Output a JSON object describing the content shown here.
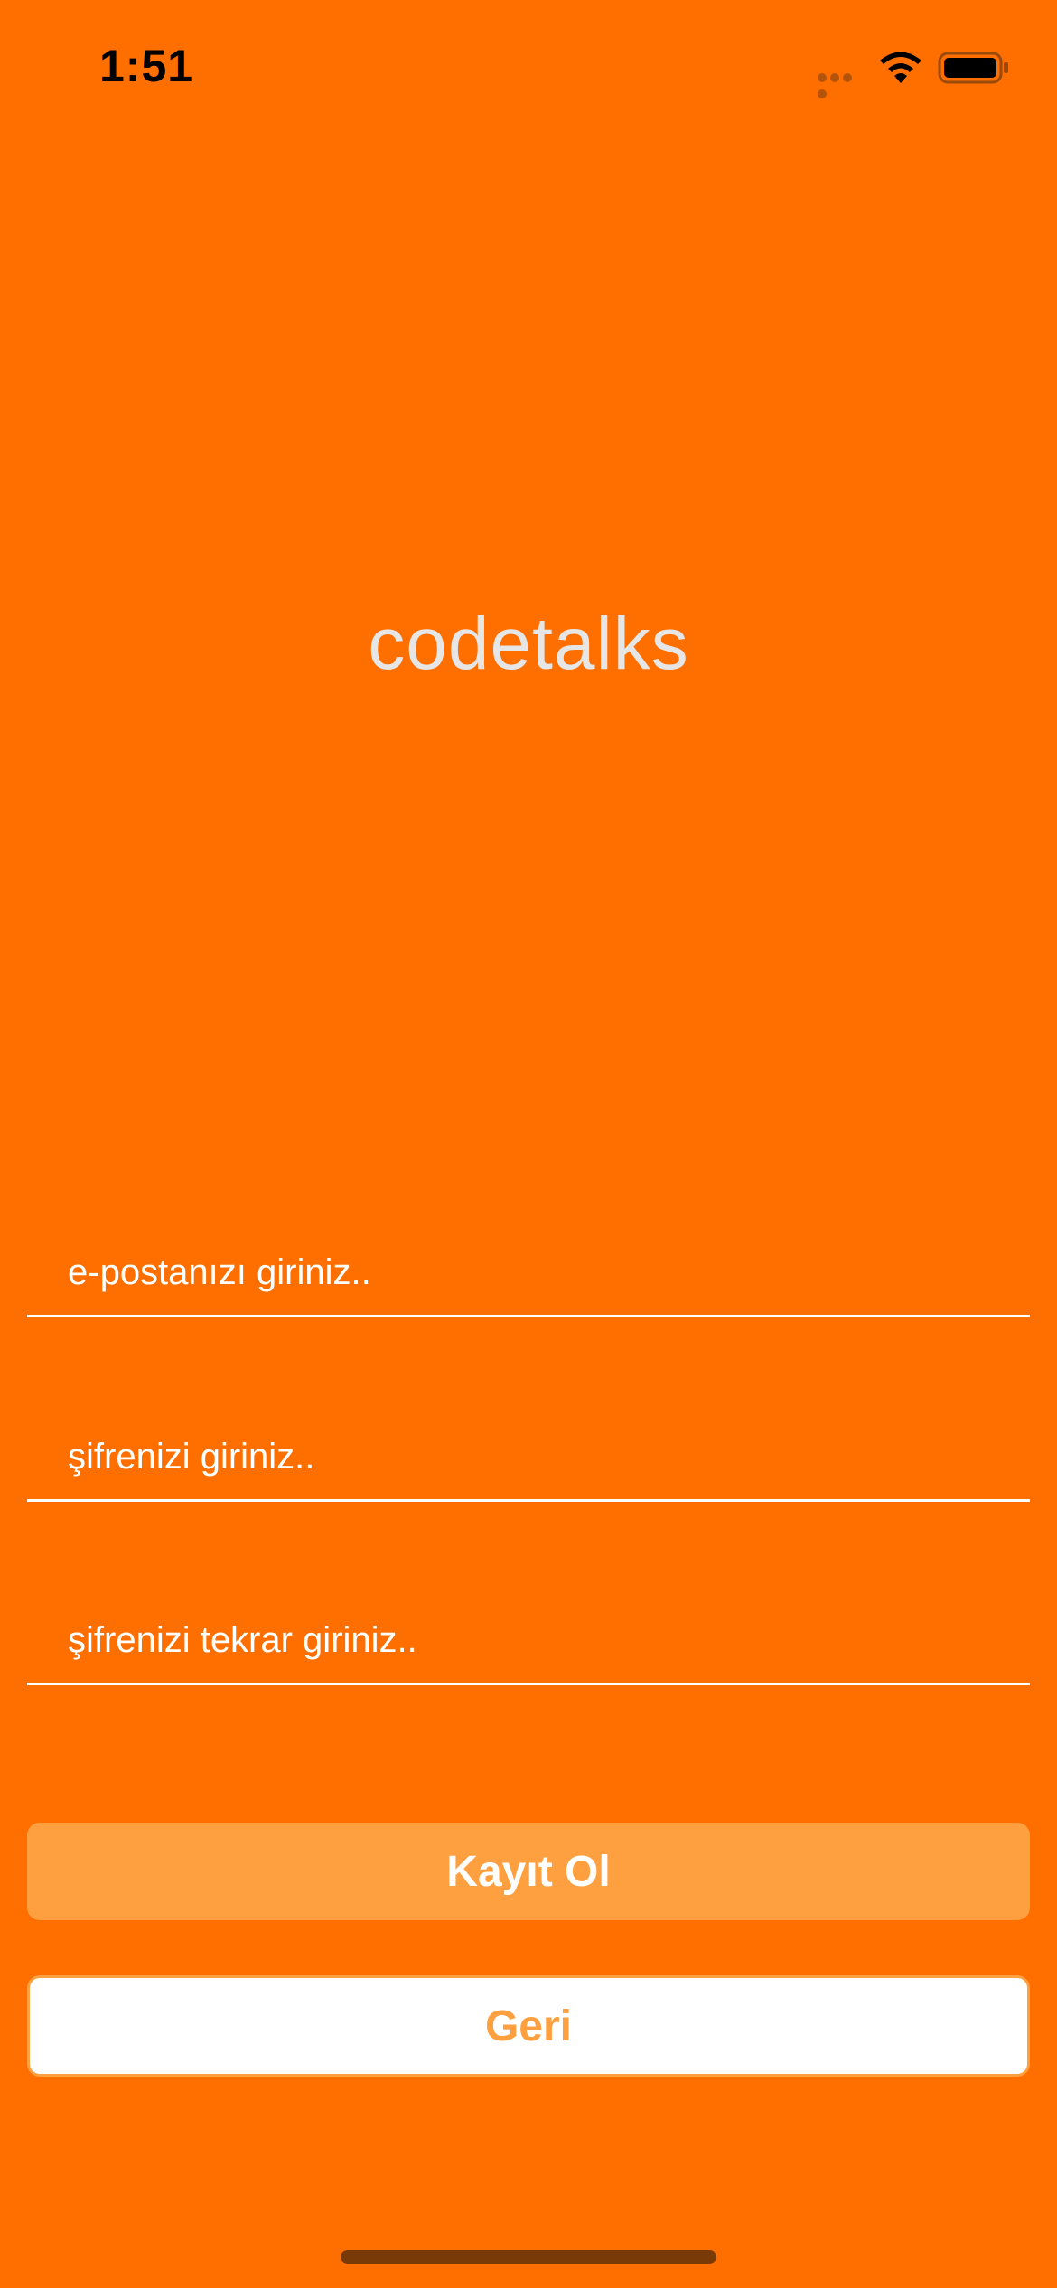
{
  "status_bar": {
    "time": "1:51",
    "icons": [
      "signal-icon",
      "wifi-icon",
      "battery-icon"
    ]
  },
  "app": {
    "title": "codetalks"
  },
  "form": {
    "email_placeholder": "e-postanızı giriniz..",
    "password_placeholder": "şifrenizi giriniz..",
    "password_repeat_placeholder": "şifrenizi tekrar giriniz.."
  },
  "buttons": {
    "register_label": "Kayıt Ol",
    "back_label": "Geri"
  },
  "colors": {
    "background": "#FF6F00",
    "primary_button": "#FFA040",
    "secondary_button_bg": "#FFFFFF",
    "title_text": "#E6E6E6"
  }
}
